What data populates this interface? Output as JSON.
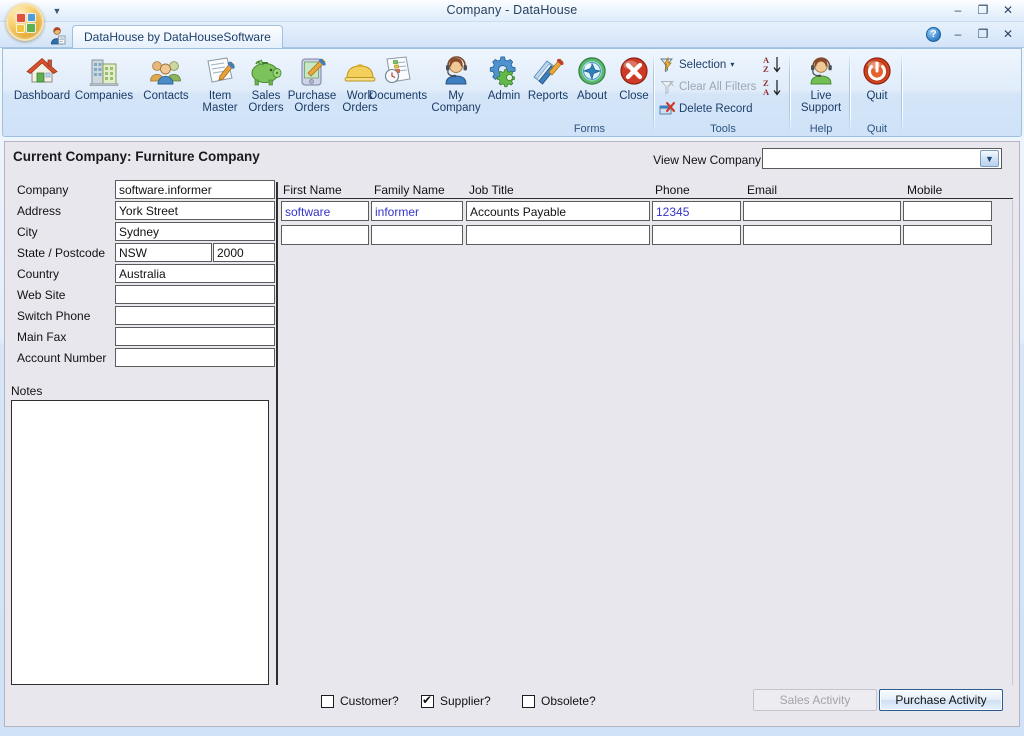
{
  "window": {
    "title": "Company - DataHouse",
    "controls": {
      "minimize": "–",
      "maximize": "❐",
      "close": "✕"
    }
  },
  "tabstrip": {
    "doc_tab_label": "DataHouse by DataHouseSoftware",
    "help_glyph": "?",
    "controls": {
      "minimize": "–",
      "maximize": "❐",
      "close": "✕"
    }
  },
  "ribbon": {
    "groups": [
      {
        "name": "Forms",
        "label": "Forms",
        "buttons": [
          {
            "label": "Dashboard",
            "icon": "house-icon"
          },
          {
            "label": "Companies",
            "icon": "office-building-icon"
          },
          {
            "label": "Contacts",
            "icon": "people-icon"
          },
          {
            "label": "Item\nMaster",
            "line1": "Item",
            "line2": "Master",
            "icon": "clipboard-pen-icon"
          },
          {
            "label": "Sales\nOrders",
            "line1": "Sales",
            "line2": "Orders",
            "icon": "piggy-bank-icon"
          },
          {
            "label": "Purchase\nOrders",
            "line1": "Purchase",
            "line2": "Orders",
            "icon": "pda-pen-icon"
          },
          {
            "label": "Work\nOrders",
            "line1": "Work",
            "line2": "Orders",
            "icon": "hard-hat-icon"
          },
          {
            "label": "Documents",
            "icon": "document-clock-icon"
          },
          {
            "label": "My\nCompany",
            "line1": "My",
            "line2": "Company",
            "icon": "headset-person-icon"
          },
          {
            "label": "Admin",
            "icon": "gears-icon"
          },
          {
            "label": "Reports",
            "icon": "books-pen-icon"
          },
          {
            "label": "About",
            "icon": "globe-compass-icon"
          },
          {
            "label": "Close",
            "icon": "red-x-circle-icon"
          }
        ]
      },
      {
        "name": "Tools",
        "label": "Tools",
        "commands": [
          {
            "label": "Selection",
            "icon": "filter-lightning-icon",
            "has_dropdown": true,
            "dropdown_glyph": "▾",
            "disabled": false
          },
          {
            "label": "Clear All Filters",
            "icon": "filter-clear-icon",
            "disabled": true
          },
          {
            "label": "Delete Record",
            "icon": "delete-record-icon",
            "disabled": false
          }
        ],
        "sorts": [
          {
            "name": "sort-ascending",
            "top": "A",
            "bottom": "Z",
            "arrow": "↓"
          },
          {
            "name": "sort-descending",
            "top": "Z",
            "bottom": "A",
            "arrow": "↓"
          }
        ]
      },
      {
        "name": "Help",
        "label": "Help",
        "buttons": [
          {
            "label": "Live\nSupport",
            "line1": "Live",
            "line2": "Support",
            "icon": "headset-support-icon"
          }
        ]
      },
      {
        "name": "Quit",
        "label": "Quit",
        "buttons": [
          {
            "label": "Quit",
            "icon": "power-button-icon"
          }
        ]
      }
    ]
  },
  "page": {
    "header": "Current Company: Furniture Company",
    "view_new_company": {
      "label": "View New Company",
      "value": "",
      "placeholder": ""
    }
  },
  "company_form": {
    "fields": [
      {
        "label": "Company",
        "value": "software.informer",
        "name": "company"
      },
      {
        "label": "Address",
        "value": "York Street",
        "name": "address"
      },
      {
        "label": "City",
        "value": "Sydney",
        "name": "city"
      },
      {
        "label": "State / Postcode",
        "value": "NSW",
        "value2": "2000",
        "name": "state-postcode"
      },
      {
        "label": "Country",
        "value": "Australia",
        "name": "country"
      },
      {
        "label": "Web Site",
        "value": "",
        "name": "web-site"
      },
      {
        "label": "Switch Phone",
        "value": "",
        "name": "switch-phone"
      },
      {
        "label": "Main Fax",
        "value": "",
        "name": "main-fax"
      },
      {
        "label": "Account Number",
        "value": "",
        "name": "account-number"
      }
    ],
    "notes_label": "Notes",
    "notes_value": ""
  },
  "contacts_grid": {
    "columns": [
      "First Name",
      "Family Name",
      "Job Title",
      "Phone",
      "Email",
      "Mobile"
    ],
    "rows": [
      {
        "first_name": "software",
        "family_name": "informer",
        "job_title": "Accounts Payable",
        "phone": "12345",
        "email": "",
        "mobile": ""
      },
      {
        "first_name": "",
        "family_name": "",
        "job_title": "",
        "phone": "",
        "email": "",
        "mobile": ""
      }
    ]
  },
  "bottom_bar": {
    "checkboxes": [
      {
        "label": "Customer?",
        "checked": false,
        "name": "customer"
      },
      {
        "label": "Supplier?",
        "checked": true,
        "name": "supplier"
      },
      {
        "label": "Obsolete?",
        "checked": false,
        "name": "obsolete"
      }
    ],
    "buttons": [
      {
        "label": "Sales Activity",
        "enabled": false,
        "name": "sales-activity"
      },
      {
        "label": "Purchase Activity",
        "enabled": true,
        "name": "purchase-activity"
      }
    ]
  },
  "colors": {
    "ribbon_blue": "#cfe2f7",
    "client_background": "#e9e7ee",
    "field_text": "#111111",
    "contact_link_text": "#3333cc",
    "accent_border": "#9dbfe2"
  }
}
